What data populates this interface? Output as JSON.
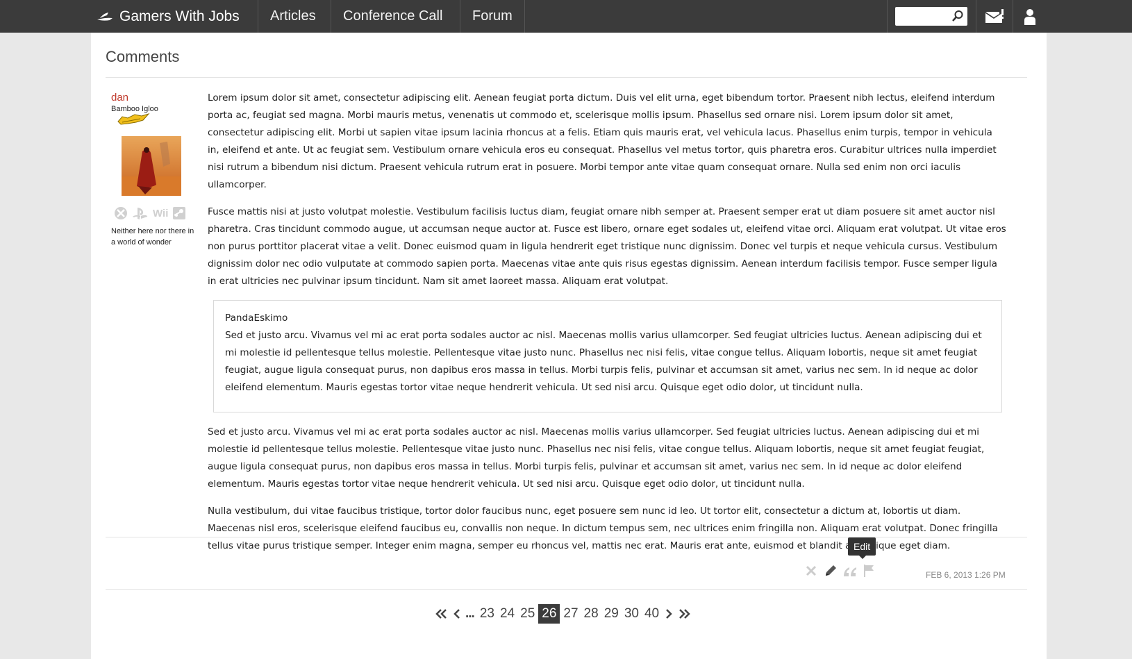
{
  "nav": {
    "brand": "Gamers With Jobs",
    "links": [
      "Articles",
      "Conference Call",
      "Forum"
    ],
    "search_placeholder": ""
  },
  "page": {
    "heading": "Comments"
  },
  "post": {
    "author": "dan",
    "author_title": "Bamboo Igloo",
    "platforms": [
      "xbox",
      "playstation",
      "Wii",
      "steam"
    ],
    "tagline": "Neither here nor there in a world of wonder",
    "paragraphs": [
      "Lorem ipsum dolor sit amet, consectetur adipiscing elit. Aenean feugiat porta dictum. Duis vel elit urna, eget bibendum tortor. Praesent nibh lectus, eleifend interdum porta ac, feugiat sed magna. Morbi mauris metus, venenatis ut commodo et, scelerisque mollis ipsum. Phasellus sed ornare nisi. Lorem ipsum dolor sit amet, consectetur adipiscing elit. Morbi ut sapien vitae ipsum lacinia rhoncus at a felis. Etiam quis mauris erat, vel vehicula lacus. Phasellus enim turpis, tempor in vehicula in, eleifend et ante. Ut ac feugiat sem. Vestibulum ornare vehicula eros eu consequat. Phasellus vel metus tortor, quis pharetra eros. Curabitur ultrices nulla imperdiet nisi rutrum a bibendum nisi dictum. Praesent vehicula rutrum erat in posuere. Morbi tempor ante vitae quam consequat ornare. Nulla sed enim non orci iaculis ullamcorper.",
      "Fusce mattis nisi at justo volutpat molestie. Vestibulum facilisis luctus diam, feugiat ornare nibh semper at. Praesent semper erat ut diam posuere sit amet auctor nisl pharetra. Cras tincidunt commodo augue, ut accumsan neque auctor at. Fusce est libero, ornare eget sodales ut, eleifend vitae orci. Aliquam erat volutpat. Ut vitae eros non purus porttitor placerat vitae a velit. Donec euismod quam in ligula hendrerit eget tristique nunc dignissim. Donec vel turpis et neque vehicula cursus. Vestibulum dignissim dolor nec odio vulputate at commodo sapien porta. Maecenas vitae ante quis risus egestas dignissim. Aenean interdum facilisis tempor. Fusce semper ligula in erat ultricies nec pulvinar ipsum tincidunt. Nam sit amet laoreet massa. Aliquam erat volutpat."
    ],
    "quote": {
      "author": "PandaEskimo",
      "text": "Sed et justo arcu. Vivamus vel mi ac erat porta sodales auctor ac nisl. Maecenas mollis varius ullamcorper. Sed feugiat ultricies luctus. Aenean adipiscing dui et mi molestie id pellentesque tellus molestie. Pellentesque vitae justo nunc. Phasellus nec nisi felis, vitae congue tellus. Aliquam lobortis, neque sit amet feugiat feugiat, augue ligula consequat purus, non dapibus eros massa in tellus. Morbi turpis felis, pulvinar et accumsan sit amet, varius nec sem. In id neque ac dolor eleifend elementum. Mauris egestas tortor vitae neque hendrerit vehicula. Ut sed nisi arcu. Quisque eget odio dolor, ut tincidunt nulla."
    },
    "paragraphs_after": [
      "Sed et justo arcu. Vivamus vel mi ac erat porta sodales auctor ac nisl. Maecenas mollis varius ullamcorper. Sed feugiat ultricies luctus. Aenean adipiscing dui et mi molestie id pellentesque tellus molestie. Pellentesque vitae justo nunc. Phasellus nec nisi felis, vitae congue tellus. Aliquam lobortis, neque sit amet feugiat feugiat, augue ligula consequat purus, non dapibus eros massa in tellus. Morbi turpis felis, pulvinar et accumsan sit amet, varius nec sem. In id neque ac dolor eleifend elementum. Mauris egestas tortor vitae neque hendrerit vehicula. Ut sed nisi arcu. Quisque eget odio dolor, ut tincidunt nulla.",
      "Nulla vestibulum, dui vitae faucibus tristique, tortor dolor faucibus nunc, eget posuere sem nunc id leo. Ut tortor elit, consectetur a dictum at, lobortis ut diam. Maecenas nisl eros, scelerisque eleifend faucibus eu, convallis non neque. In dictum tempus sem, nec ultrices enim fringilla non. Aliquam erat volutpat. Donec fringilla tellus vitae purus tristique semper. Integer enim magna, semper eu rhoncus vel, mattis nec erat. Mauris erat ante, euismod et blandit a, tristique eget diam."
    ],
    "actions": [
      "delete-icon",
      "edit-icon",
      "quote-icon",
      "flag-icon"
    ],
    "tooltip": "Edit",
    "date": "FEB 6, 2013 1:26 PM"
  },
  "pagination": {
    "ellipsis": "...",
    "pages": [
      "23",
      "24",
      "25",
      "26",
      "27",
      "28",
      "29",
      "30",
      "40"
    ],
    "current": "26"
  },
  "colors": {
    "topbar": "#3b3b3b",
    "username": "#c0392b",
    "background": "#e8e8e8"
  }
}
